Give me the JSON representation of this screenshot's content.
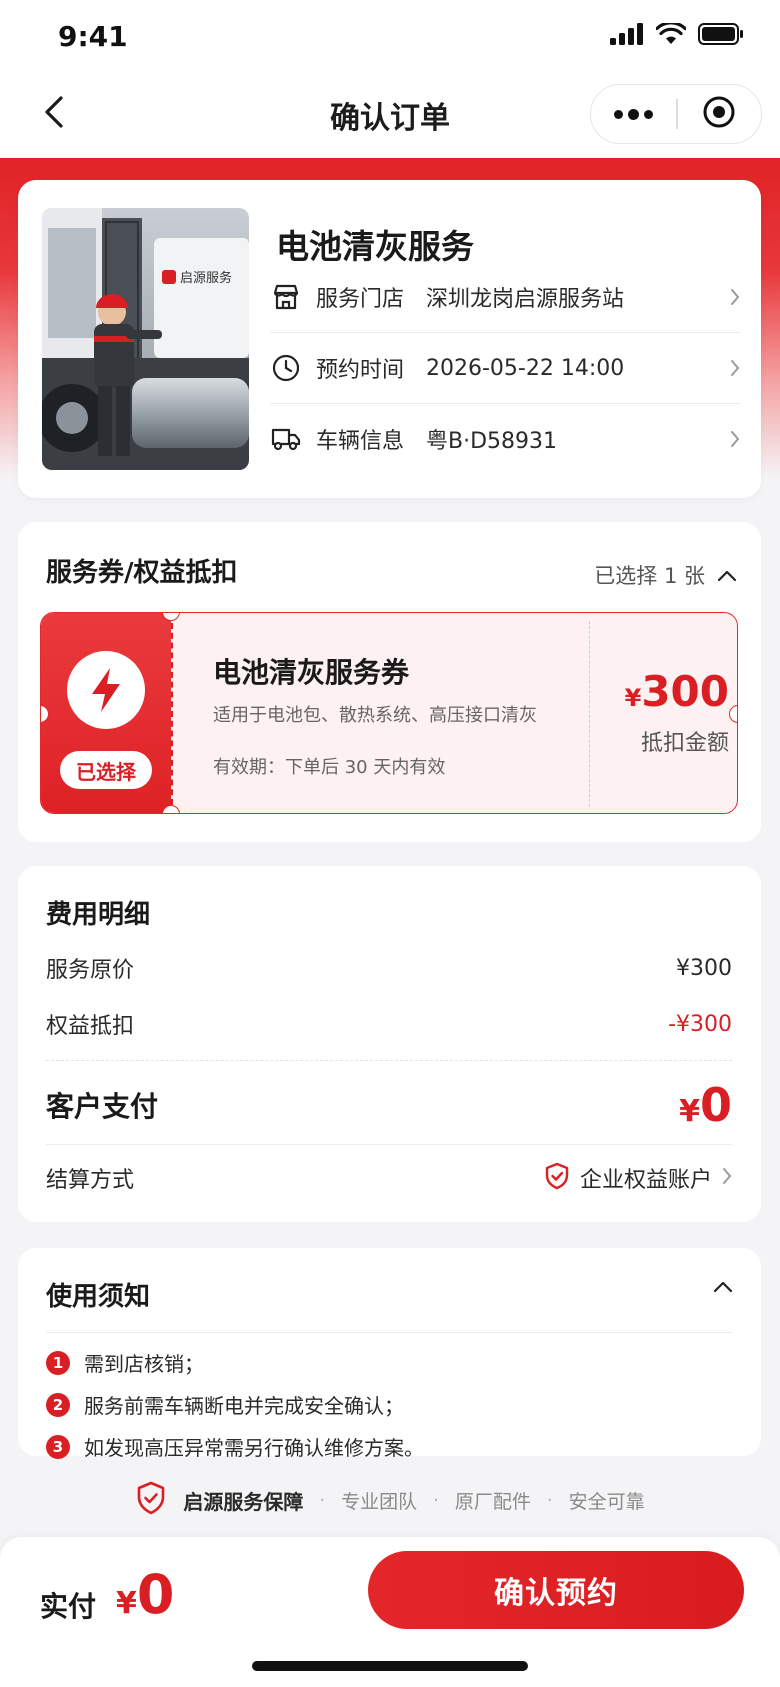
{
  "status_bar": {
    "time": "9:41"
  },
  "nav": {
    "title": "确认订单"
  },
  "service": {
    "title": "电池清灰服务",
    "rows": [
      {
        "icon": "store-icon",
        "label": "服务门店",
        "value": "深圳龙岗启源服务站"
      },
      {
        "icon": "clock-icon",
        "label": "预约时间",
        "value": "2026-05-22 14:00"
      },
      {
        "icon": "truck-icon",
        "label": "车辆信息",
        "value": "粤B·D58931"
      }
    ],
    "photo_sign": "启源服务"
  },
  "coupon": {
    "section_title": "服务券/权益抵扣",
    "selected_text": "已选择 1 张",
    "ticket": {
      "chip": "已选择",
      "name": "电池清灰服务券",
      "desc": "适用于电池包、散热系统、高压接口清灰",
      "validity": "有效期：下单后 30 天内有效",
      "currency": "¥",
      "amount": "300",
      "amount_label": "抵扣金额"
    }
  },
  "fees": {
    "section_title": "费用明细",
    "original_label": "服务原价",
    "original_value": "¥300",
    "deduct_label": "权益抵扣",
    "deduct_value": "-¥300",
    "pay_label": "客户支付",
    "pay_currency": "¥",
    "pay_amount": "0",
    "settle_label": "结算方式",
    "settle_value": "企业权益账户"
  },
  "notice": {
    "section_title": "使用须知",
    "items": [
      {
        "num": "1",
        "text": "需到店核销；"
      },
      {
        "num": "2",
        "text": "服务前需车辆断电并完成安全确认；"
      },
      {
        "num": "3",
        "text": "如发现高压异常需另行确认维修方案。"
      }
    ]
  },
  "guarantee": {
    "main": "启源服务保障",
    "items": [
      "专业团队",
      "原厂配件",
      "安全可靠"
    ],
    "separator": "·"
  },
  "bottom": {
    "paid_label": "实付",
    "currency": "¥",
    "amount": "0",
    "confirm": "确认预约"
  },
  "colors": {
    "accent": "#d91f24",
    "background": "#f4f4f6"
  }
}
